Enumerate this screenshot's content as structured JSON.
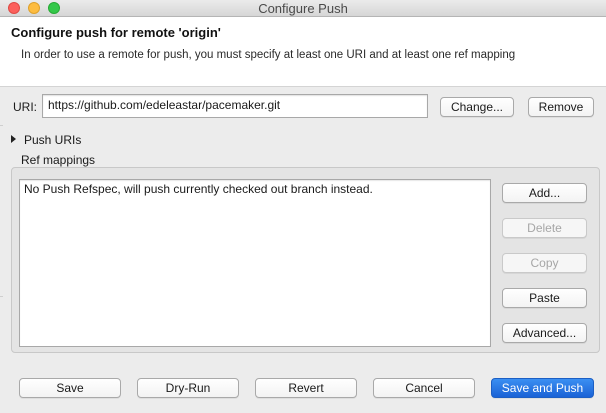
{
  "window": {
    "title": "Configure Push"
  },
  "header": {
    "title": "Configure push for remote 'origin'",
    "description": "In order to use a remote for push, you must specify at least one URI and at least one ref mapping"
  },
  "uri": {
    "label": "URI:",
    "value": "https://github.com/edeleastar/pacemaker.git",
    "change_label": "Change...",
    "remove_label": "Remove"
  },
  "push_uris": {
    "label": "Push URIs",
    "expanded": false
  },
  "ref_mappings": {
    "label": "Ref mappings",
    "placeholder_text": "No Push Refspec, will push currently checked out branch instead.",
    "buttons": {
      "add": "Add...",
      "delete": "Delete",
      "copy": "Copy",
      "paste": "Paste",
      "advanced": "Advanced..."
    }
  },
  "footer": {
    "save": "Save",
    "dry_run": "Dry-Run",
    "revert": "Revert",
    "cancel": "Cancel",
    "save_and_push": "Save and Push"
  },
  "colors": {
    "accent": "#1a62d6",
    "close": "#fc605c",
    "minimize": "#fdbc40",
    "maximize": "#34c84a"
  }
}
